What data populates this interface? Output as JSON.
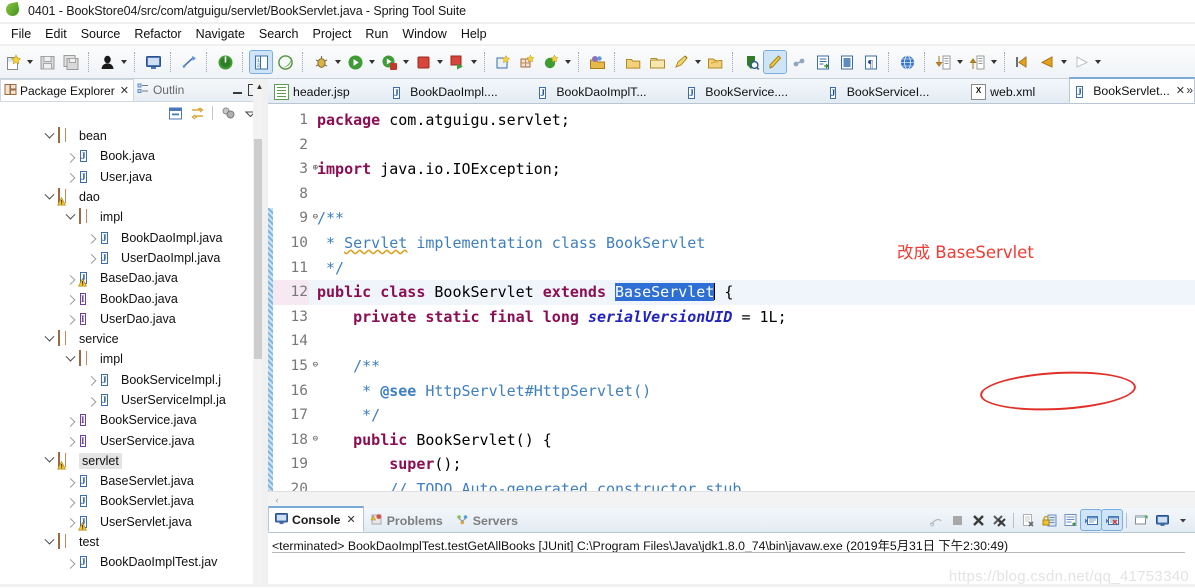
{
  "window": {
    "title": "0401 - BookStore04/src/com/atguigu/servlet/BookServlet.java - Spring Tool Suite",
    "app_icon": "spring-leaf-icon"
  },
  "menu": {
    "items": [
      "File",
      "Edit",
      "Source",
      "Refactor",
      "Navigate",
      "Search",
      "Project",
      "Run",
      "Window",
      "Help"
    ]
  },
  "toolbar": {
    "groups": [
      {
        "items": [
          {
            "name": "new-wizard-icon",
            "dropdown": true
          },
          {
            "name": "save-icon",
            "dropdown": false
          },
          {
            "name": "save-all-icon",
            "dropdown": false
          }
        ]
      },
      {
        "items": [
          {
            "name": "user-profile-icon",
            "dropdown": true
          }
        ]
      },
      {
        "items": [
          {
            "name": "open-console-icon",
            "dropdown": false
          }
        ]
      },
      {
        "items": [
          {
            "name": "toggle-mark-occurrences-icon",
            "dropdown": false
          }
        ]
      },
      {
        "items": [
          {
            "name": "boot-dashboard-icon",
            "dropdown": false
          }
        ]
      },
      {
        "items": [
          {
            "name": "spring-explorer-icon",
            "selected": true,
            "dropdown": false
          },
          {
            "name": "spring-leaf-icon",
            "dropdown": false
          }
        ]
      },
      {
        "items": [
          {
            "name": "debug-icon",
            "dropdown": true
          },
          {
            "name": "run-icon",
            "dropdown": true
          },
          {
            "name": "run-last-tool-icon",
            "dropdown": true
          },
          {
            "name": "terminate-icon",
            "dropdown": true
          },
          {
            "name": "run-server-icon",
            "dropdown": true
          }
        ]
      },
      {
        "items": [
          {
            "name": "new-java-project-icon",
            "dropdown": false
          },
          {
            "name": "new-package-icon",
            "dropdown": false
          },
          {
            "name": "new-class-icon",
            "dropdown": true
          }
        ]
      },
      {
        "items": [
          {
            "name": "open-type-icon",
            "dropdown": false
          }
        ]
      },
      {
        "items": [
          {
            "name": "open-resource-icon",
            "dropdown": false
          },
          {
            "name": "open-folder-icon",
            "dropdown": false
          },
          {
            "name": "quick-fix-icon",
            "dropdown": true
          },
          {
            "name": "open-task-icon",
            "dropdown": false
          }
        ]
      },
      {
        "items": [
          {
            "name": "search-icon",
            "dropdown": false
          },
          {
            "name": "highlight-icon",
            "selected": true,
            "dropdown": false
          },
          {
            "name": "link-icon",
            "dropdown": false
          },
          {
            "name": "next-annotation-icon",
            "dropdown": false
          },
          {
            "name": "show-whitespace-icon",
            "dropdown": false
          },
          {
            "name": "pilcrow-icon",
            "dropdown": false
          }
        ]
      },
      {
        "items": [
          {
            "name": "open-browser-icon",
            "dropdown": false
          }
        ]
      },
      {
        "items": [
          {
            "name": "next-edit-icon",
            "dropdown": true
          },
          {
            "name": "previous-edit-icon",
            "dropdown": true
          }
        ]
      },
      {
        "items": [
          {
            "name": "back-history-icon",
            "dropdown": false
          },
          {
            "name": "back-nav-icon",
            "dropdown": true
          },
          {
            "name": "forward-nav-icon",
            "dropdown": true
          }
        ]
      }
    ]
  },
  "package_explorer": {
    "tabs": [
      {
        "label": "Package Explorer",
        "icon": "package-explorer-icon",
        "active": true,
        "closable": true
      },
      {
        "label": "Outlin",
        "icon": "outline-icon",
        "active": false,
        "closable": false
      }
    ],
    "view_buttons": [
      {
        "name": "collapse-all-icon"
      },
      {
        "name": "link-with-editor-icon"
      },
      {
        "name": "focus-active-task-icon"
      },
      {
        "name": "view-menu-icon"
      }
    ],
    "tree": [
      {
        "label": "bean",
        "icon": "package-icon",
        "indent": 1,
        "expanded": true,
        "twisty": "down"
      },
      {
        "label": "Book.java",
        "icon": "java-file-icon",
        "indent": 2,
        "twisty": "right"
      },
      {
        "label": "User.java",
        "icon": "java-file-icon",
        "indent": 2,
        "twisty": "right"
      },
      {
        "label": "dao",
        "icon": "package-icon",
        "indent": 1,
        "expanded": true,
        "twisty": "down",
        "warning": true
      },
      {
        "label": "impl",
        "icon": "package-icon",
        "indent": 2,
        "expanded": true,
        "twisty": "down"
      },
      {
        "label": "BookDaoImpl.java",
        "icon": "java-file-icon",
        "indent": 3,
        "twisty": "right"
      },
      {
        "label": "UserDaoImpl.java",
        "icon": "java-file-icon",
        "indent": 3,
        "twisty": "right"
      },
      {
        "label": "BaseDao.java",
        "icon": "java-file-icon",
        "indent": 2,
        "twisty": "right",
        "warning": true
      },
      {
        "label": "BookDao.java",
        "icon": "java-interface-icon",
        "indent": 2,
        "twisty": "right"
      },
      {
        "label": "UserDao.java",
        "icon": "java-interface-icon",
        "indent": 2,
        "twisty": "right"
      },
      {
        "label": "service",
        "icon": "package-icon",
        "indent": 1,
        "expanded": true,
        "twisty": "down"
      },
      {
        "label": "impl",
        "icon": "package-icon",
        "indent": 2,
        "expanded": true,
        "twisty": "down"
      },
      {
        "label": "BookServiceImpl.j",
        "icon": "java-file-icon",
        "indent": 3,
        "twisty": "right"
      },
      {
        "label": "UserServiceImpl.ja",
        "icon": "java-file-icon",
        "indent": 3,
        "twisty": "right"
      },
      {
        "label": "BookService.java",
        "icon": "java-interface-icon",
        "indent": 2,
        "twisty": "right"
      },
      {
        "label": "UserService.java",
        "icon": "java-interface-icon",
        "indent": 2,
        "twisty": "right"
      },
      {
        "label": "servlet",
        "icon": "package-icon",
        "indent": 1,
        "expanded": true,
        "twisty": "down",
        "warning": true,
        "selected": true
      },
      {
        "label": "BaseServlet.java",
        "icon": "java-file-icon",
        "indent": 2,
        "twisty": "right"
      },
      {
        "label": "BookServlet.java",
        "icon": "java-file-icon",
        "indent": 2,
        "twisty": "right"
      },
      {
        "label": "UserServlet.java",
        "icon": "java-file-icon",
        "indent": 2,
        "twisty": "right",
        "warning": true
      },
      {
        "label": "test",
        "icon": "package-icon",
        "indent": 1,
        "expanded": true,
        "twisty": "down"
      },
      {
        "label": "BookDaoImplTest.jav",
        "icon": "java-test-icon",
        "indent": 2,
        "twisty": "right"
      }
    ]
  },
  "editor": {
    "tabs": [
      {
        "label": "header.jsp",
        "icon": "jsp-file-icon",
        "active": false
      },
      {
        "label": "BookDaoImpl....",
        "icon": "java-file-icon",
        "active": false
      },
      {
        "label": "BookDaoImplT...",
        "icon": "java-file-icon",
        "active": false
      },
      {
        "label": "BookService....",
        "icon": "java-file-icon",
        "active": false
      },
      {
        "label": "BookServiceI...",
        "icon": "java-file-icon",
        "active": false
      },
      {
        "label": "web.xml",
        "icon": "xml-file-icon",
        "active": false
      },
      {
        "label": "BookServlet...",
        "icon": "java-file-icon",
        "active": true,
        "closable": true
      }
    ],
    "tab_overflow": "»",
    "lines": [
      {
        "num": "1",
        "fold": "",
        "text": "package com.atguigu.servlet;"
      },
      {
        "num": "2",
        "fold": "",
        "text": ""
      },
      {
        "num": "3",
        "fold": "+",
        "text": "import java.io.IOException;"
      },
      {
        "num": "8",
        "fold": "",
        "text": ""
      },
      {
        "num": "9",
        "fold": "-",
        "text": "/**"
      },
      {
        "num": "10",
        "fold": "",
        "text": " * Servlet implementation class BookServlet"
      },
      {
        "num": "11",
        "fold": "",
        "text": " */"
      },
      {
        "num": "12",
        "fold": "",
        "text": "public class BookServlet extends BaseServlet {",
        "current": true
      },
      {
        "num": "13",
        "fold": "",
        "text": "    private static final long serialVersionUID = 1L;"
      },
      {
        "num": "14",
        "fold": "",
        "text": ""
      },
      {
        "num": "15",
        "fold": "-",
        "text": "    /**"
      },
      {
        "num": "16",
        "fold": "",
        "text": "     * @see HttpServlet#HttpServlet()"
      },
      {
        "num": "17",
        "fold": "",
        "text": "     */"
      },
      {
        "num": "18",
        "fold": "-",
        "text": "    public BookServlet() {"
      },
      {
        "num": "19",
        "fold": "",
        "text": "        super();"
      },
      {
        "num": "20",
        "fold": "",
        "text": "        // TODO Auto-generated constructor stub"
      }
    ],
    "selected_text": "BaseServlet",
    "annotation": {
      "text": "改成 BaseServlet",
      "color": "#ef3b33"
    }
  },
  "console": {
    "tabs": [
      {
        "label": "Console",
        "icon": "console-icon",
        "active": true,
        "closable": true
      },
      {
        "label": "Problems",
        "icon": "problems-icon",
        "active": false
      },
      {
        "label": "Servers",
        "icon": "servers-icon",
        "active": false
      }
    ],
    "toolbar": [
      {
        "name": "pin-console-icon",
        "on": false
      },
      {
        "name": "terminate-icon",
        "on": false
      },
      {
        "name": "remove-launch-icon",
        "on": false
      },
      {
        "name": "remove-all-terminated-icon",
        "on": false
      },
      {
        "name": "clear-console-icon",
        "on": false
      },
      {
        "name": "scroll-lock-icon",
        "on": false
      },
      {
        "name": "word-wrap-icon",
        "on": false
      },
      {
        "name": "show-console-on-output-icon",
        "on": true
      },
      {
        "name": "show-console-on-error-icon",
        "on": true
      },
      {
        "name": "pin-console-view-icon",
        "on": false
      },
      {
        "name": "display-selected-console-icon",
        "on": false
      },
      {
        "name": "open-console-menu-icon",
        "on": false
      }
    ],
    "output": "<terminated> BookDaoImplTest.testGetAllBooks [JUnit] C:\\Program Files\\Java\\jdk1.8.0_74\\bin\\javaw.exe (2019年5月31日 下午2:30:49)"
  },
  "watermark": "https://blog.csdn.net/qq_41753340"
}
